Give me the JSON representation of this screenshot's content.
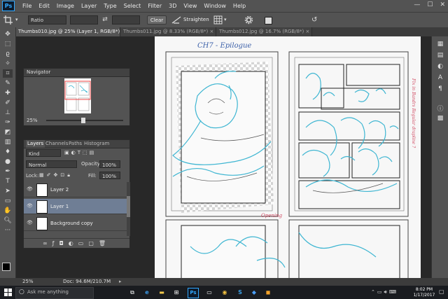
{
  "app": {
    "logo": "Ps"
  },
  "menu": [
    "File",
    "Edit",
    "Image",
    "Layer",
    "Type",
    "Select",
    "Filter",
    "3D",
    "View",
    "Window",
    "Help"
  ],
  "window_controls": {
    "minimize": "—",
    "maximize": "☐",
    "close": "✕"
  },
  "options_bar": {
    "ratio_value": "Ratio",
    "swap_icon": "⇄",
    "clear_label": "Clear",
    "straighten_label": "Straighten",
    "reset_icon": "↺"
  },
  "tabs": [
    {
      "label": "Thumbs010.jpg @ 25% (Layer 1, RGB/8*) ×",
      "active": true
    },
    {
      "label": "Thumbs011.jpg @ 8.33% (RGB/8*) ×",
      "active": false
    },
    {
      "label": "Thumbs012.jpg @ 16.7% (RGB/8*) ×",
      "active": false
    }
  ],
  "navigator": {
    "title": "Navigator",
    "zoom": "25%"
  },
  "layers_panel": {
    "tabs": [
      "Layers",
      "Channels",
      "Paths",
      "Histogram"
    ],
    "filter_kind": "Kind",
    "blend_mode": "Normal",
    "opacity_label": "Opacity:",
    "opacity_value": "100%",
    "lock_label": "Lock:",
    "fill_label": "Fill:",
    "fill_value": "100%",
    "layers": [
      {
        "name": "Layer 2",
        "selected": false
      },
      {
        "name": "Layer 1",
        "selected": true
      },
      {
        "name": "Background copy",
        "selected": false
      }
    ],
    "footer_icons": [
      "link-icon",
      "fx-icon",
      "mask-icon",
      "adjustment-icon",
      "group-icon",
      "new-layer-icon",
      "trash-icon"
    ]
  },
  "canvas": {
    "top_title": "CH7 - Epilogue",
    "side_note": "Opening",
    "margin_note": "Fix in Bandrs Regular drapline ?"
  },
  "status": {
    "zoom": "25%",
    "doc": "Doc: 94.6M/210.7M"
  },
  "taskbar": {
    "search_placeholder": "Ask me anything",
    "time": "8:02 PM",
    "date": "1/17/2017"
  },
  "colors": {
    "accent": "#31a8ff",
    "panel": "#535353",
    "canvas_bg": "#282828",
    "sketch_blue": "#3fb6d2",
    "selected_layer": "#6f7e95"
  }
}
